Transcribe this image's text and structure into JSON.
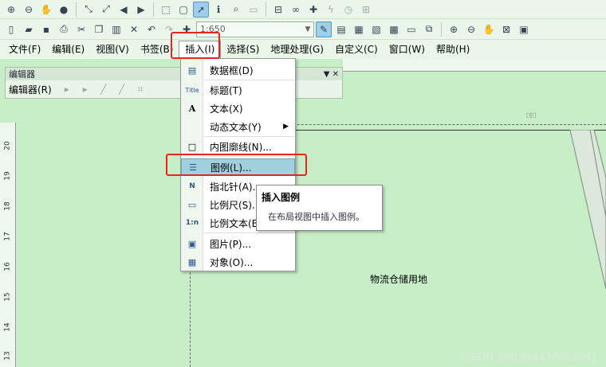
{
  "toolbar1": {
    "icons": [
      "zoom-in-icon",
      "zoom-out-icon",
      "pan-icon",
      "globe-icon",
      "fixed-zoom-in-icon",
      "fixed-zoom-out-icon",
      "back-icon",
      "forward-icon",
      "select-features-icon",
      "clear-selection-icon",
      "select-elements-icon",
      "identify-icon",
      "find-icon",
      "html-popup-icon",
      "measure-icon",
      "binoculars-icon",
      "go-to-xy-icon",
      "hyperlink-icon",
      "time-slider-icon",
      "create-viewer-icon"
    ]
  },
  "toolbar2": {
    "scale_value": "1:650"
  },
  "menubar": {
    "items": [
      "文件(F)",
      "编辑(E)",
      "视图(V)",
      "书签(B)",
      "插入(I)",
      "选择(S)",
      "地理处理(G)",
      "自定义(C)",
      "窗口(W)",
      "帮助(H)"
    ],
    "open_index": 4
  },
  "editor_panel": {
    "title": "编辑器",
    "dropdown_label": "编辑器(R)"
  },
  "insert_menu": {
    "items": [
      {
        "label": "数据框(D)",
        "icon": "data-frame-icon",
        "glyph": "▤"
      },
      {
        "label": "标题(T)",
        "icon": "title-icon",
        "glyph": "Title"
      },
      {
        "label": "文本(X)",
        "icon": "text-icon",
        "glyph": "A"
      },
      {
        "label": "动态文本(Y)",
        "icon": "",
        "glyph": ""
      },
      {
        "label": "内图廓线(N)...",
        "icon": "neatline-icon",
        "glyph": "□"
      },
      {
        "label": "图例(L)...",
        "icon": "legend-icon",
        "glyph": "☰"
      },
      {
        "label": "指北针(A)...",
        "icon": "north-arrow-icon",
        "glyph": "N"
      },
      {
        "label": "比例尺(S)...",
        "icon": "scale-bar-icon",
        "glyph": "▭"
      },
      {
        "label": "比例文本(E)...",
        "icon": "scale-text-icon",
        "glyph": "1:n"
      },
      {
        "label": "图片(P)...",
        "icon": "picture-icon",
        "glyph": "▣"
      },
      {
        "label": "对象(O)...",
        "icon": "object-icon",
        "glyph": "▦"
      }
    ],
    "highlighted_index": 5
  },
  "tooltip": {
    "title": "插入图例",
    "body": "在布局视图中插入图例。"
  },
  "map": {
    "polygon_label": "物流仓储用地",
    "small_mark": "[空]"
  },
  "ruler_left_ticks": [
    "20",
    "19",
    "18",
    "17",
    "16",
    "15",
    "14",
    "13"
  ],
  "watermark": "CSDN @山水(443440204)",
  "colors": {
    "map_green": "#c8eec8",
    "highlight": "#9fd0de",
    "annotation_red": "#e8251f"
  }
}
